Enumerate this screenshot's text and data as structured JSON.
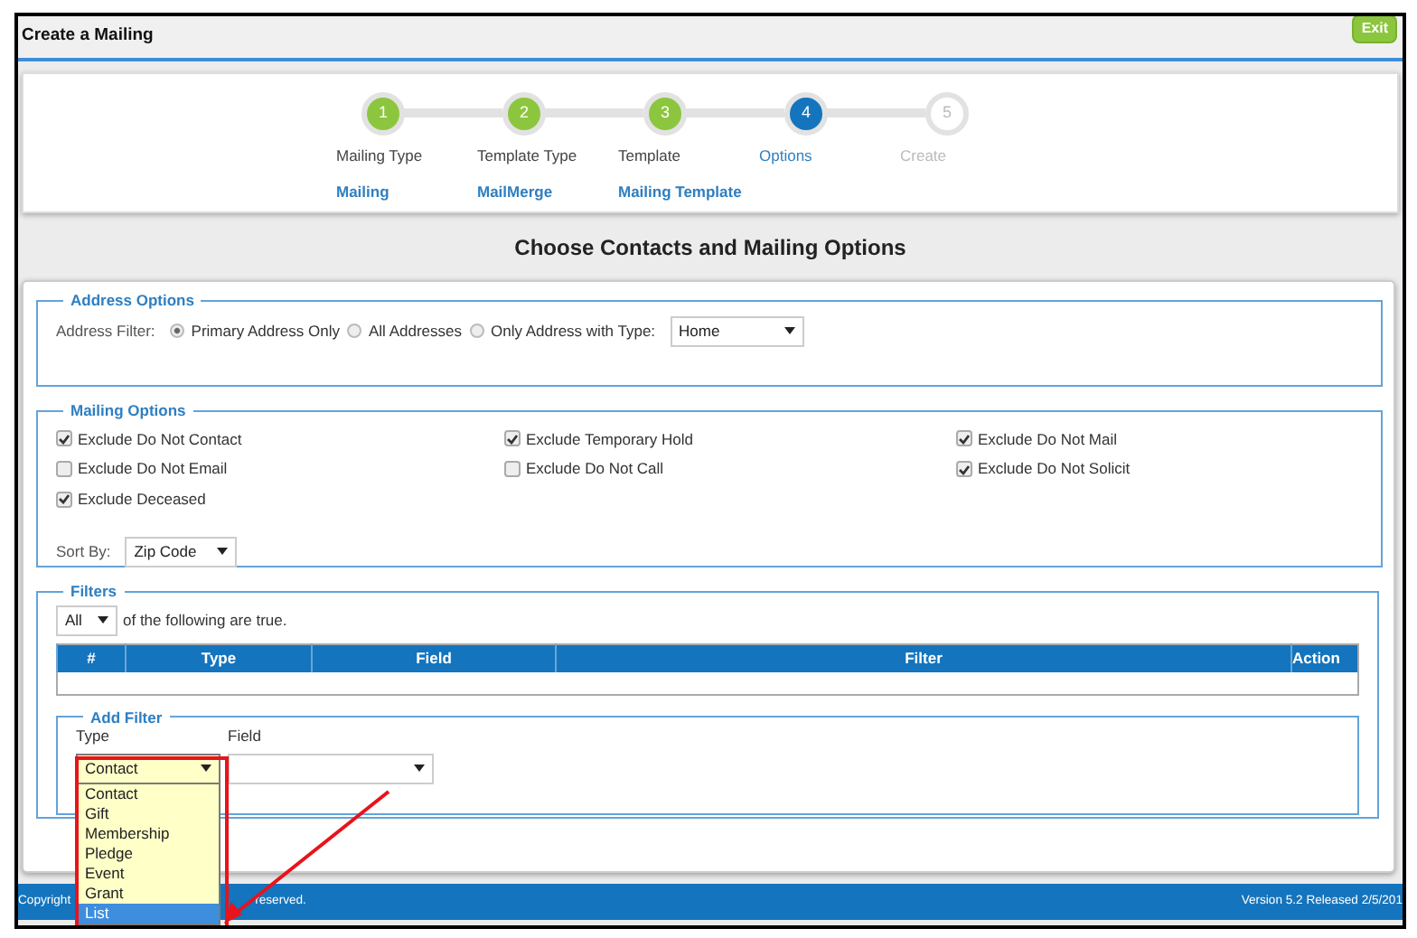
{
  "window": {
    "title": "Create a Mailing",
    "exit_button": "Exit"
  },
  "wizard": {
    "steps": [
      {
        "number": "1",
        "label": "Mailing Type",
        "value": "Mailing",
        "completed": true,
        "selected": false
      },
      {
        "number": "2",
        "label": "Template Type",
        "value": "MailMerge",
        "completed": true,
        "selected": false
      },
      {
        "number": "3",
        "label": "Template",
        "value": "Mailing Template",
        "completed": true,
        "selected": false
      },
      {
        "number": "4",
        "label": "Options",
        "completed": false,
        "selected": true
      },
      {
        "number": "5",
        "label": "Create",
        "completed": false,
        "selected": false
      }
    ]
  },
  "heading": "Choose Contacts and Mailing Options",
  "address_options": {
    "legend": "Address Options",
    "label": "Address Filter:",
    "choices": [
      {
        "label": "Primary Address Only",
        "selected": true
      },
      {
        "label": "All Addresses",
        "selected": false
      },
      {
        "label": "Only Address with Type:",
        "selected": false
      }
    ],
    "type_select": "Home"
  },
  "mailing_options": {
    "legend": "Mailing Options",
    "checkboxes": [
      {
        "label": "Exclude Do Not Contact",
        "checked": true
      },
      {
        "label": "Exclude Temporary Hold",
        "checked": true
      },
      {
        "label": "Exclude Do Not Mail",
        "checked": true
      },
      {
        "label": "Exclude Do Not Email",
        "checked": false
      },
      {
        "label": "Exclude Do Not Call",
        "checked": false
      },
      {
        "label": "Exclude Do Not Solicit",
        "checked": true
      },
      {
        "label": "Exclude Deceased",
        "checked": true
      }
    ],
    "sort_label": "Sort By:",
    "sort_select": "Zip Code"
  },
  "filters": {
    "legend": "Filters",
    "match_select": "All",
    "match_text": "of the following are true.",
    "columns": [
      "#",
      "Type",
      "Field",
      "Filter",
      "Action"
    ]
  },
  "add_filter": {
    "legend": "Add Filter",
    "type_label": "Type",
    "type_select": "Contact",
    "field_label": "Field",
    "type_options": [
      {
        "label": "Contact",
        "selected": false
      },
      {
        "label": "Gift",
        "selected": false
      },
      {
        "label": "Membership",
        "selected": false
      },
      {
        "label": "Pledge",
        "selected": false
      },
      {
        "label": "Event",
        "selected": false
      },
      {
        "label": "Grant",
        "selected": false
      },
      {
        "label": "List",
        "selected": true
      }
    ]
  },
  "footer": {
    "left": "Copyright",
    "left_end": "reserved.",
    "right": "Version 5.2 Released 2/5/201"
  }
}
